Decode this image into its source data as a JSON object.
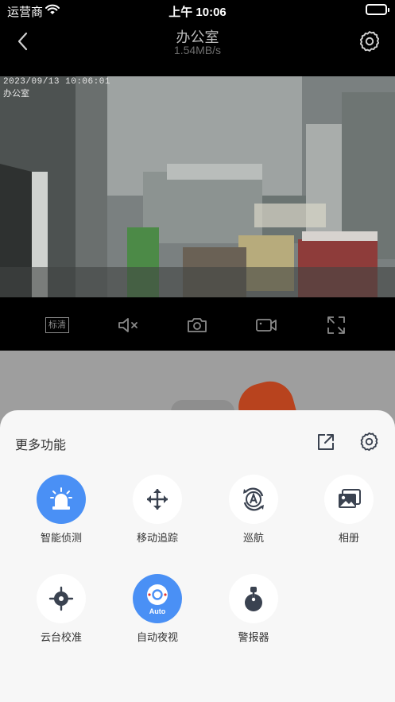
{
  "status_bar": {
    "carrier": "运营商",
    "time": "上午 10:06"
  },
  "nav": {
    "title": "办公室",
    "speed": "1.54MB/s"
  },
  "video": {
    "timestamp": "2023/09/13 10:06:01",
    "camera_name": "办公室"
  },
  "toolbar": {
    "quality_label": "标清"
  },
  "sheet": {
    "title": "更多功能",
    "features": [
      {
        "label": "智能侦测",
        "icon": "alarm-light-icon",
        "active": true
      },
      {
        "label": "移动追踪",
        "icon": "move-arrows-icon",
        "active": false
      },
      {
        "label": "巡航",
        "icon": "cruise-rotate-icon",
        "active": false
      },
      {
        "label": "相册",
        "icon": "album-icon",
        "active": false
      },
      {
        "label": "云台校准",
        "icon": "calibrate-crosshair-icon",
        "active": false
      },
      {
        "label": "自动夜视",
        "icon": "auto-night-vision-icon",
        "active": true,
        "badge": "Auto"
      },
      {
        "label": "警报器",
        "icon": "siren-joystick-icon",
        "active": false
      }
    ]
  },
  "colors": {
    "accent": "#4a90f5",
    "icon_dark": "#3a4250",
    "sheet_bg": "#f7f7f7"
  }
}
